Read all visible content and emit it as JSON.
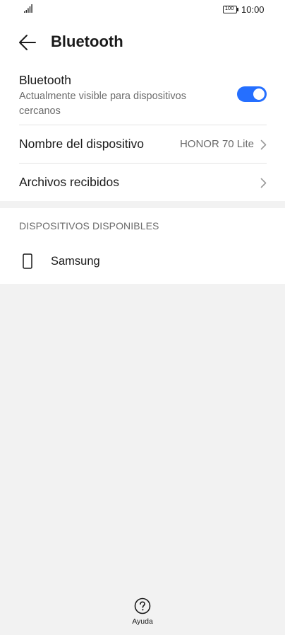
{
  "status_bar": {
    "signal_icon": "signal-bars-icon",
    "battery_level": "100",
    "time": "10:00"
  },
  "header": {
    "back_icon": "arrow-left-icon",
    "title": "Bluetooth"
  },
  "bluetooth_toggle": {
    "label": "Bluetooth",
    "subtitle": "Actualmente visible para dispositivos cercanos",
    "enabled": true,
    "accent_color": "#256fff"
  },
  "device_name_row": {
    "label": "Nombre del dispositivo",
    "value": "HONOR 70 Lite",
    "chevron_icon": "chevron-right-icon"
  },
  "received_files_row": {
    "label": "Archivos recibidos",
    "chevron_icon": "chevron-right-icon"
  },
  "available_devices": {
    "header": "DISPOSITIVOS DISPONIBLES",
    "items": [
      {
        "name": "Samsung",
        "icon": "phone-icon"
      }
    ]
  },
  "footer": {
    "help_icon": "question-circle-icon",
    "help_label": "Ayuda"
  }
}
